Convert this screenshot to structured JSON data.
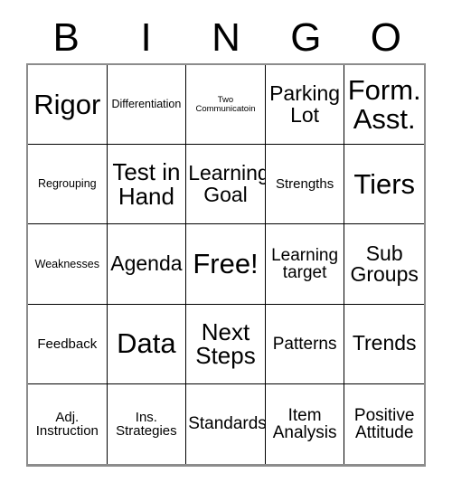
{
  "card": {
    "title": "BINGO",
    "header_letters": [
      "B",
      "I",
      "N",
      "G",
      "O"
    ],
    "colors": {
      "text": "#000000",
      "cell_border": "#000000",
      "outer_border": "#8c8c8c",
      "background": "#ffffff"
    },
    "grid": {
      "columns": 5,
      "rows": 5,
      "free_space_label": "Free!",
      "cells": [
        {
          "label": "Rigor",
          "size": "xxl"
        },
        {
          "label": "Differentiation",
          "size": "xs"
        },
        {
          "label": "Two\nCommunicatoin",
          "size": "xxs"
        },
        {
          "label": "Parking\nLot",
          "size": "lg"
        },
        {
          "label": "Form.\nAsst.",
          "size": "xxl"
        },
        {
          "label": "Regrouping",
          "size": "xs"
        },
        {
          "label": "Test in\nHand",
          "size": "xl"
        },
        {
          "label": "Learning\nGoal",
          "size": "lg"
        },
        {
          "label": "Strengths",
          "size": "sm"
        },
        {
          "label": "Tiers",
          "size": "xxl"
        },
        {
          "label": "Weaknesses",
          "size": "xs"
        },
        {
          "label": "Agenda",
          "size": "lg"
        },
        {
          "label": "Free!",
          "size": "xxl"
        },
        {
          "label": "Learning\ntarget",
          "size": "md"
        },
        {
          "label": "Sub\nGroups",
          "size": "lg"
        },
        {
          "label": "Feedback",
          "size": "sm"
        },
        {
          "label": "Data",
          "size": "xxl"
        },
        {
          "label": "Next\nSteps",
          "size": "xl"
        },
        {
          "label": "Patterns",
          "size": "md"
        },
        {
          "label": "Trends",
          "size": "lg"
        },
        {
          "label": "Adj.\nInstruction",
          "size": "sm"
        },
        {
          "label": "Ins.\nStrategies",
          "size": "sm"
        },
        {
          "label": "Standards",
          "size": "md"
        },
        {
          "label": "Item\nAnalysis",
          "size": "md"
        },
        {
          "label": "Positive\nAttitude",
          "size": "md"
        }
      ]
    }
  }
}
